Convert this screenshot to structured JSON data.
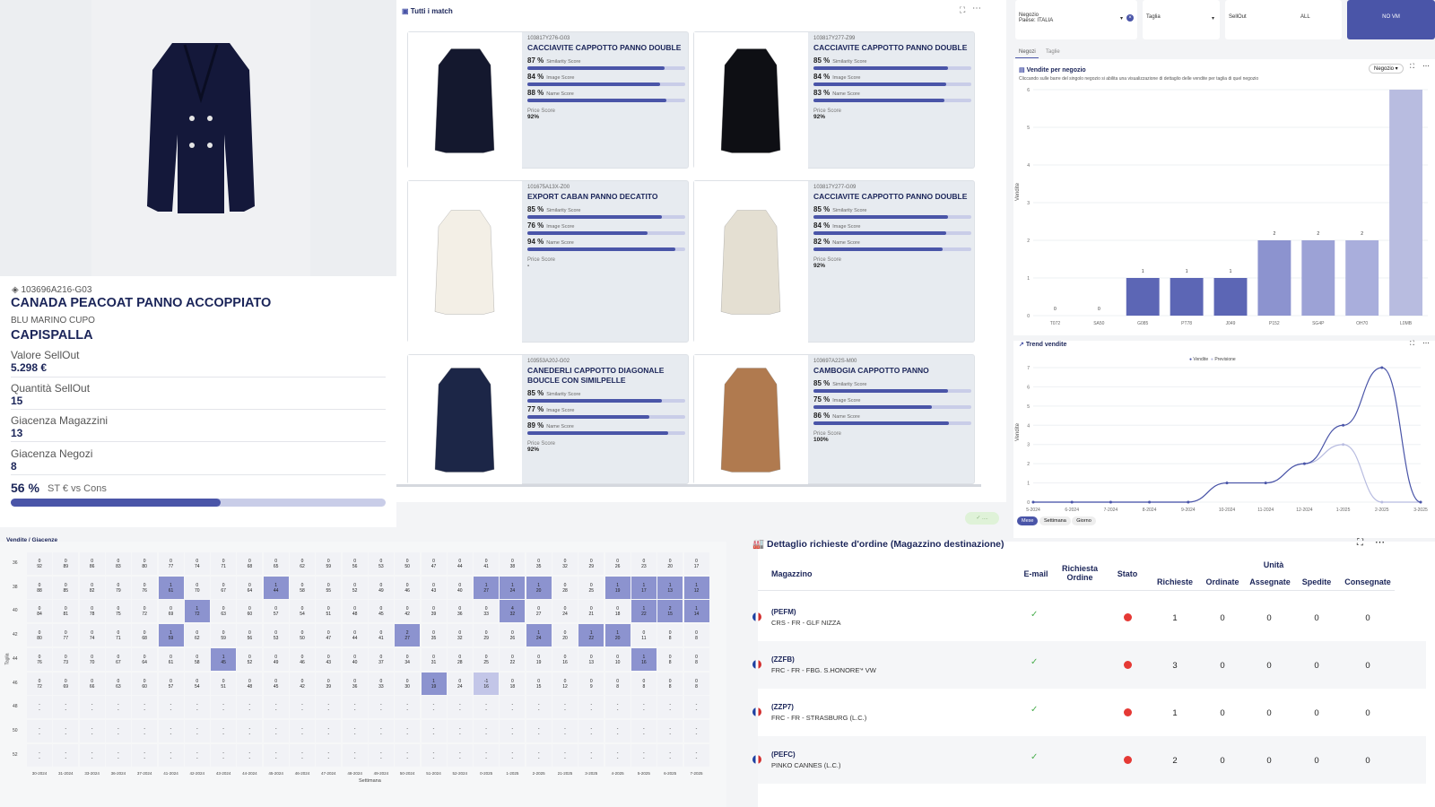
{
  "product": {
    "code": "103696A216-G03",
    "name": "CANADA PEACOAT PANNO ACCOPPIATO",
    "color": "BLU MARINO CUPO",
    "category": "CAPISPALLA",
    "metrics": [
      {
        "label": "Valore SellOut",
        "value": "5.298 €"
      },
      {
        "label": "Quantità SellOut",
        "value": "15"
      },
      {
        "label": "Giacenza Magazzini",
        "value": "13"
      },
      {
        "label": "Giacenza Negozi",
        "value": "8"
      }
    ],
    "st_pct": "56 %",
    "st_label": "ST € vs Cons",
    "st_fraction": 0.56
  },
  "matches": {
    "title": "Tutti i match",
    "score_labels": {
      "sim": "Similarity Score",
      "img": "Image Score",
      "name": "Name Score",
      "price": "Price Score"
    },
    "items": [
      {
        "code": "103817Y276-G03",
        "title": "CACCIAVITE CAPPOTTO PANNO DOUBLE",
        "sim": "87 %",
        "simv": 0.87,
        "img": "84 %",
        "imgv": 0.84,
        "name": "88 %",
        "namev": 0.88,
        "price": "92%",
        "coat": "#14182e"
      },
      {
        "code": "103817Y277-Z99",
        "title": "CACCIAVITE CAPPOTTO PANNO DOUBLE",
        "sim": "85 %",
        "simv": 0.85,
        "img": "84 %",
        "imgv": 0.84,
        "name": "83 %",
        "namev": 0.83,
        "price": "92%",
        "coat": "#0e0f14"
      },
      {
        "code": "101675A13X-Z00",
        "title": "EXPORT CABAN PANNO DECATITO",
        "sim": "85 %",
        "simv": 0.85,
        "img": "76 %",
        "imgv": 0.76,
        "name": "94 %",
        "namev": 0.94,
        "price": "-",
        "coat": "#f3efe6"
      },
      {
        "code": "103817Y277-G09",
        "title": "CACCIAVITE CAPPOTTO PANNO DOUBLE",
        "sim": "85 %",
        "simv": 0.85,
        "img": "84 %",
        "imgv": 0.84,
        "name": "82 %",
        "namev": 0.82,
        "price": "92%",
        "coat": "#e4dfd2"
      },
      {
        "code": "103553A20J-G02",
        "title": "CANEDERLI CAPPOTTO DIAGONALE BOUCLE CON SIMILPELLE",
        "sim": "85 %",
        "simv": 0.85,
        "img": "77 %",
        "imgv": 0.77,
        "name": "89 %",
        "namev": 0.89,
        "price": "92%",
        "coat": "#1c2647"
      },
      {
        "code": "103697A22S-M00",
        "title": "CAMBOGIA CAPPOTTO PANNO",
        "sim": "85 %",
        "simv": 0.85,
        "img": "75 %",
        "imgv": 0.75,
        "name": "86 %",
        "namev": 0.86,
        "price": "100%",
        "coat": "#b07a4f"
      }
    ]
  },
  "filters": {
    "negozio_label": "Negozio",
    "negozio_value": "Paese: ITALIA",
    "taglia_label": "Taglia",
    "sellout_label": "SellOut",
    "all_label": "ALL",
    "novm_label": "NO VM",
    "tab1": "Negozi",
    "tab2": "Taglie"
  },
  "sales_chart": {
    "title": "Vendite per negozio",
    "subtitle": "Cliccando sulle barre del singolo negozio si abilita una visualizzazione di dettaglio delle vendite per taglia di quel negozio",
    "dropdown": "Negozio",
    "ylabel": "Vendite",
    "chart_data": {
      "type": "bar",
      "categories": [
        "T072",
        "SA50",
        "G085",
        "PT78",
        "J049",
        "P152",
        "SG4P",
        "OH70",
        "L0MB"
      ],
      "values": [
        0,
        0,
        1,
        1,
        1,
        2,
        2,
        2,
        6
      ],
      "ylim": [
        0,
        6
      ]
    }
  },
  "trend_chart": {
    "title": "Trend vendite",
    "legend": [
      "Vendite",
      "Previsione"
    ],
    "ylabel": "Vendite",
    "buttons": [
      "Mese",
      "Settimana",
      "Giorno"
    ],
    "chart_data": {
      "type": "line",
      "x": [
        "5-2024",
        "6-2024",
        "7-2024",
        "8-2024",
        "9-2024",
        "10-2024",
        "11-2024",
        "12-2024",
        "1-2025",
        "2-2025",
        "3-2025"
      ],
      "series": [
        {
          "name": "Vendite",
          "values": [
            0,
            0,
            0,
            0,
            0,
            1,
            1,
            2,
            4,
            7,
            0
          ]
        },
        {
          "name": "Previsione",
          "values": [
            0,
            0,
            0,
            0,
            0,
            1,
            1,
            2,
            3,
            0,
            0
          ]
        }
      ],
      "ylim": [
        0,
        7
      ]
    }
  },
  "heatmap": {
    "title": "Vendite / Giacenze",
    "xlabel": "Settimana",
    "ylabel": "Taglia",
    "rows": [
      "36",
      "38",
      "40",
      "42",
      "44",
      "46",
      "48",
      "50",
      "52"
    ],
    "cols": [
      "30-2024",
      "31-2024",
      "33-2024",
      "36-2024",
      "37-2024",
      "41-2024",
      "42-2024",
      "43-2024",
      "44-2024",
      "45-2024",
      "46-2024",
      "47-2024",
      "48-2024",
      "49-2024",
      "50-2024",
      "51-2024",
      "52-2024",
      "0-2025",
      "1-2025",
      "2-2025",
      "21-2025",
      "3-2025",
      "4-2025",
      "5-2025",
      "6-2025",
      "7-2025"
    ]
  },
  "orders": {
    "title": "Dettaglio richieste d'ordine (Magazzino destinazione)",
    "headers": {
      "store": "Magazzino",
      "email": "E-mail",
      "req": "Richiesta Ordine",
      "status": "Stato",
      "units": "Unità",
      "c1": "Richieste",
      "c2": "Ordinate",
      "c3": "Assegnate",
      "c4": "Spedite",
      "c5": "Consegnate"
    },
    "rows": [
      {
        "code": "(PEFM)",
        "desc": "CRS - FR - GLF NIZZA",
        "v": [
          "1",
          "0",
          "0",
          "0",
          "0"
        ]
      },
      {
        "code": "(ZZFB)",
        "desc": "FRC - FR - FBG. S.HONORE'* VW",
        "v": [
          "3",
          "0",
          "0",
          "0",
          "0"
        ]
      },
      {
        "code": "(ZZP7)",
        "desc": "FRC - FR - STRASBURG (L.C.)",
        "v": [
          "1",
          "0",
          "0",
          "0",
          "0"
        ]
      },
      {
        "code": "(PEFC)",
        "desc": "PINKO CANNES (L.C.)",
        "v": [
          "2",
          "0",
          "0",
          "0",
          "0"
        ]
      }
    ]
  }
}
